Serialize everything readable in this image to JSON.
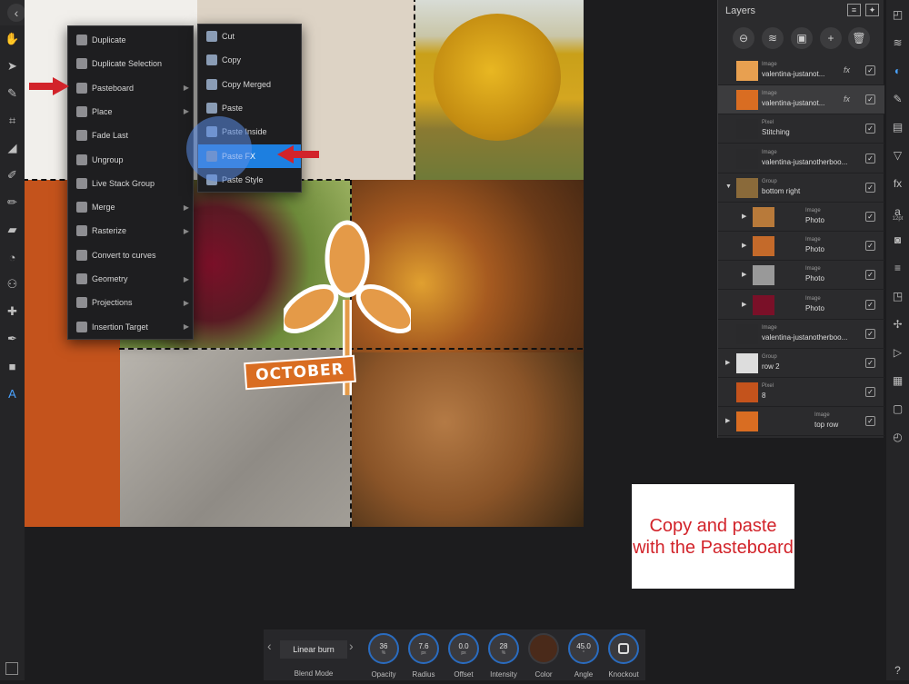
{
  "topbar": {
    "buttons": [
      "back-icon",
      "document-icon",
      "more-icon",
      "persona-photo-icon",
      "persona-liquify-icon",
      "persona-develop-icon",
      "persona-tonemap-icon",
      "persona-export-icon"
    ]
  },
  "left_tools": [
    "hand-icon",
    "move-icon",
    "color-picker-icon",
    "crop-icon",
    "fill-icon",
    "selection-brush-icon",
    "paint-brush-icon",
    "erase-icon",
    "dodge-icon",
    "clone-icon",
    "healing-icon",
    "pen-icon",
    "rectangle-icon",
    "text-icon"
  ],
  "right_tools": [
    "navigator-icon",
    "layers-icon",
    "adjustments-icon",
    "brushes-icon",
    "history-icon",
    "filters-icon",
    "fx-icon",
    "text-style-icon",
    "camera-icon",
    "channels-icon",
    "transform-icon",
    "swatches-icon",
    "live-filters-icon",
    "grid-icon",
    "stock-icon",
    "clock-icon",
    "help-icon"
  ],
  "text_style_size": "12pt",
  "help_label": "?",
  "menu": {
    "items": [
      {
        "label": "Duplicate",
        "submenu": false
      },
      {
        "label": "Duplicate Selection",
        "submenu": false
      },
      {
        "label": "Pasteboard",
        "submenu": true
      },
      {
        "label": "Place",
        "submenu": true
      },
      {
        "label": "Fade Last",
        "submenu": false
      },
      {
        "label": "Ungroup",
        "submenu": false
      },
      {
        "label": "Live Stack Group",
        "submenu": false
      },
      {
        "label": "Merge",
        "submenu": true
      },
      {
        "label": "Rasterize",
        "submenu": true
      },
      {
        "label": "Convert to curves",
        "submenu": false
      },
      {
        "label": "Geometry",
        "submenu": true
      },
      {
        "label": "Projections",
        "submenu": true
      },
      {
        "label": "Insertion Target",
        "submenu": true
      }
    ]
  },
  "submenu": {
    "items": [
      {
        "label": "Cut"
      },
      {
        "label": "Copy"
      },
      {
        "label": "Copy Merged"
      },
      {
        "label": "Paste"
      },
      {
        "label": "Paste Inside"
      },
      {
        "label": "Paste FX",
        "selected": true
      },
      {
        "label": "Paste Style"
      }
    ]
  },
  "canvas": {
    "october_text": "OCTOBER"
  },
  "layers": {
    "title": "Layers",
    "toolbar": [
      "mask-icon",
      "stack-icon",
      "live-filter-icon",
      "add-layer-icon",
      "delete-icon"
    ],
    "rows": [
      {
        "type": "Image",
        "name": "valentina-justanot...",
        "fx": true,
        "checked": true
      },
      {
        "type": "Image",
        "name": "valentina-justanot...",
        "fx": true,
        "checked": true,
        "selected": true
      },
      {
        "type": "Pixel",
        "name": "Stitching",
        "checked": true
      },
      {
        "type": "Image",
        "name": "valentina-justanotherboo...",
        "checked": true
      },
      {
        "type": "Group",
        "name": "bottom right",
        "checked": true,
        "expanded": true
      },
      {
        "type": "Image",
        "name": "Photo",
        "checked": true,
        "nested": true
      },
      {
        "type": "Image",
        "name": "Photo",
        "checked": true,
        "nested": true
      },
      {
        "type": "Image",
        "name": "Photo",
        "checked": true,
        "nested": true
      },
      {
        "type": "Image",
        "name": "Photo",
        "checked": true,
        "nested": true
      },
      {
        "type": "Image",
        "name": "valentina-justanotherboo...",
        "checked": true
      },
      {
        "type": "Group",
        "name": "row 2",
        "checked": true
      },
      {
        "type": "Pixel",
        "name": "8",
        "checked": true
      },
      {
        "type": "Image",
        "name": "top row",
        "checked": true
      }
    ]
  },
  "note": {
    "text": "Copy and paste with the Pasteboard"
  },
  "bottombar": {
    "blend_mode": "Linear burn",
    "blend_label": "Blend Mode",
    "dials": [
      {
        "value": "36",
        "unit": "%",
        "label": "Opacity"
      },
      {
        "value": "7.6",
        "unit": "px",
        "label": "Radius"
      },
      {
        "value": "0.0",
        "unit": "px",
        "label": "Offset"
      },
      {
        "value": "28",
        "unit": "%",
        "label": "Intensity"
      },
      {
        "value": "",
        "unit": "",
        "label": "Color"
      },
      {
        "value": "45.0",
        "unit": "°",
        "label": "Angle"
      },
      {
        "value": "",
        "unit": "",
        "label": "Knockout"
      }
    ],
    "color_swatch": "#4a2a1a"
  },
  "colors": {
    "accent": "#1d7fe0",
    "annotation_red": "#d2232a",
    "orange": "#c0521c"
  }
}
